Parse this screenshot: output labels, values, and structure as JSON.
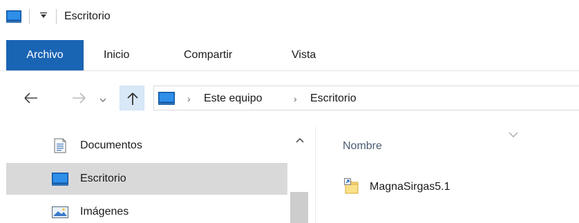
{
  "window": {
    "title": "Escritorio"
  },
  "ribbon": {
    "tabs": [
      {
        "label": "Archivo"
      },
      {
        "label": "Inicio"
      },
      {
        "label": "Compartir"
      },
      {
        "label": "Vista"
      }
    ]
  },
  "address": {
    "crumbs": [
      "Este equipo",
      "Escritorio"
    ]
  },
  "nav_pane": {
    "items": [
      {
        "label": "Documentos",
        "icon": "documents-icon"
      },
      {
        "label": "Escritorio",
        "icon": "desktop-icon",
        "selected": true
      },
      {
        "label": "Imágenes",
        "icon": "pictures-icon"
      }
    ]
  },
  "content": {
    "column_header": "Nombre",
    "files": [
      {
        "name": "MagnaSirgas5.1",
        "icon": "folder-shortcut-icon"
      }
    ]
  },
  "colors": {
    "accent": "#1a64b4",
    "selection": "#d9d9d9",
    "up_button": "#d9e8f7",
    "folder": "#f8d775"
  }
}
